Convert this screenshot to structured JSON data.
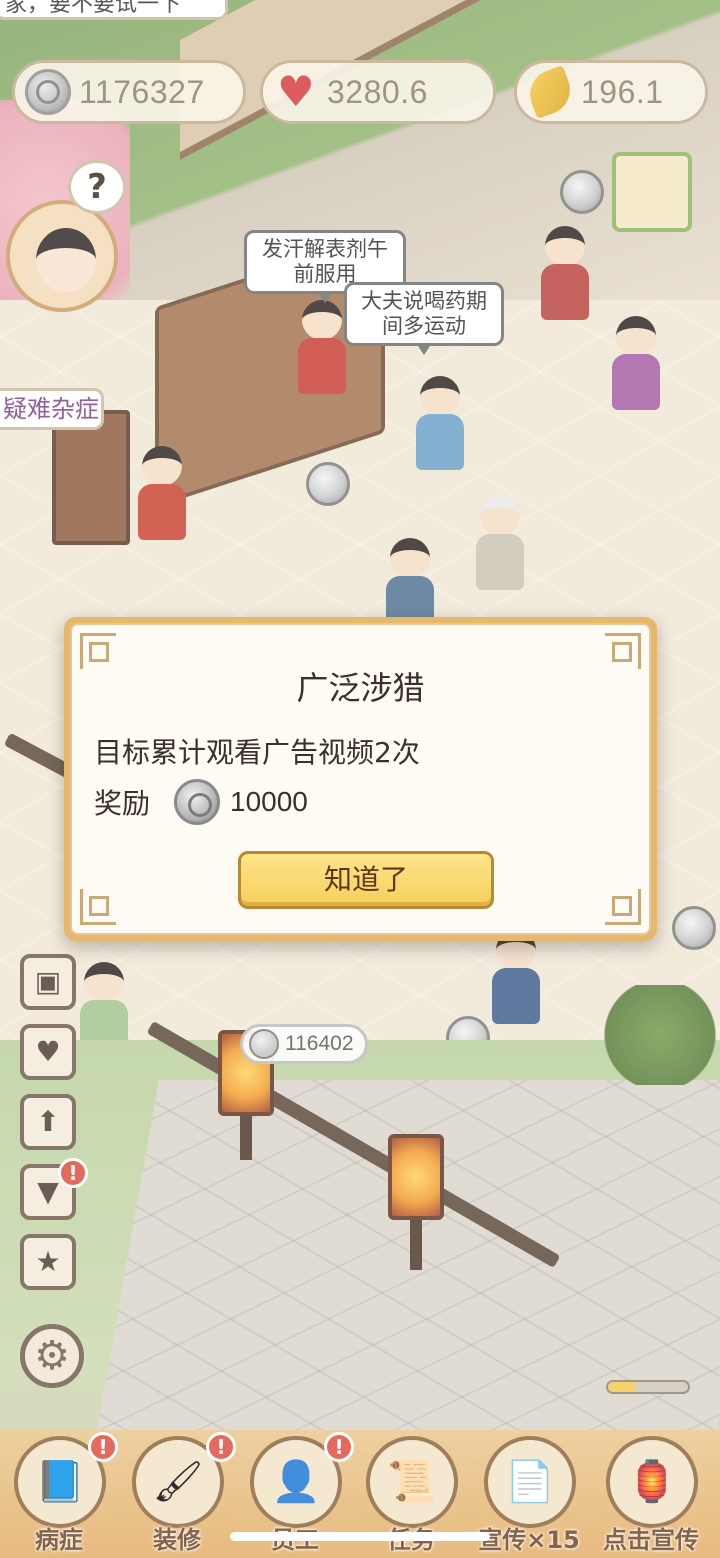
{
  "hud": {
    "silver": "1176327",
    "hearts": "3280.6",
    "leaves": "196.1",
    "top_message": "家，要不要试一下"
  },
  "scene": {
    "side_tag": "疑难杂症",
    "speech_1": "发汗解表剂午前服用",
    "speech_2": "大夫说喝药期间多运动",
    "avatar_question": "?",
    "floor_coins": "116402"
  },
  "dialog": {
    "title": "广泛涉猎",
    "goal": "目标累计观看广告视频2次",
    "reward_label": "奖励",
    "reward_amount": "10000",
    "confirm_label": "知道了"
  },
  "side_menu": {
    "items": [
      {
        "icon": "chest-icon",
        "glyph": "▣",
        "badge": false
      },
      {
        "icon": "heart-icon",
        "glyph": "♥",
        "badge": false
      },
      {
        "icon": "upgrade-icon",
        "glyph": "⬆",
        "badge": false
      },
      {
        "icon": "shirt-icon",
        "glyph": "👕",
        "badge": true
      },
      {
        "icon": "book-star-icon",
        "glyph": "★",
        "badge": false
      }
    ],
    "badge_text": "!"
  },
  "progress": {
    "value": 0.35
  },
  "bottom_nav": {
    "items": [
      {
        "label": "病症",
        "badge": true
      },
      {
        "label": "装修",
        "badge": true
      },
      {
        "label": "员工",
        "badge": true
      },
      {
        "label": "任务",
        "badge": false
      },
      {
        "label": "宣传×15",
        "badge": false
      },
      {
        "label": "点击宣传",
        "badge": false
      }
    ],
    "badge_text": "!"
  },
  "colors": {
    "dialog_border": "#e7b86a",
    "button_fill": "#f6cf5c",
    "badge_red": "#e04a3a"
  }
}
